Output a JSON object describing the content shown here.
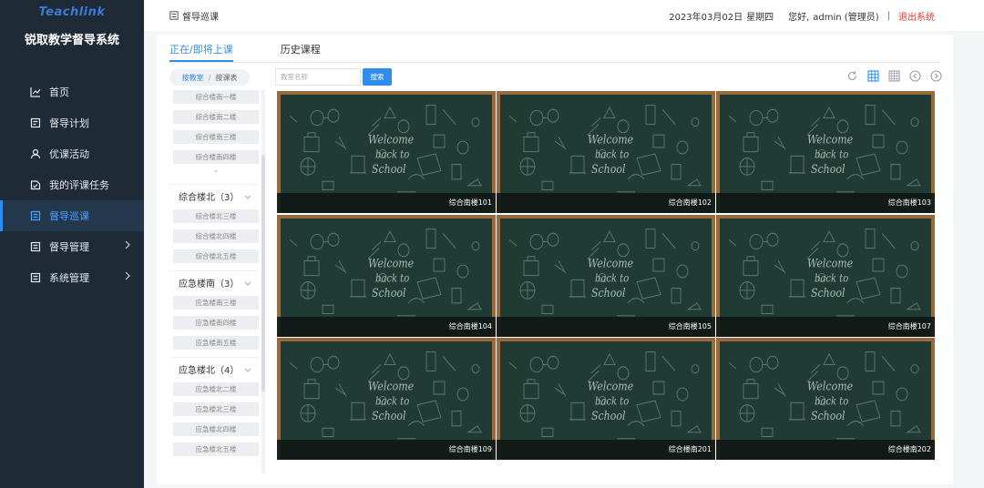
{
  "sidebar": {
    "logo_text": "Teachlink",
    "system_title": "锐取教学督导系统",
    "items": [
      {
        "label": "首页",
        "icon": "chart-icon"
      },
      {
        "label": "督导计划",
        "icon": "plan-icon"
      },
      {
        "label": "优课活动",
        "icon": "activity-icon"
      },
      {
        "label": "我的评课任务",
        "icon": "task-icon"
      },
      {
        "label": "督导巡课",
        "icon": "patrol-icon",
        "active": true
      },
      {
        "label": "督导管理",
        "icon": "manage-icon",
        "expandable": true
      },
      {
        "label": "系统管理",
        "icon": "settings-icon",
        "expandable": true
      }
    ]
  },
  "topbar": {
    "breadcrumb": "督导巡课",
    "date": "2023年03月02日",
    "weekday": "星期四",
    "greeting": "您好,",
    "user": "admin (管理员)",
    "separator": "|",
    "logout": "退出系统"
  },
  "tabs": [
    {
      "label": "正在/即将上课",
      "active": true
    },
    {
      "label": "历史课程",
      "active": false
    }
  ],
  "switcher": {
    "by_room": "按教室",
    "slash": "/",
    "by_schedule": "按课表"
  },
  "building_panel": {
    "top_rooms": [
      "综合楼南一楼",
      "综合楼南二楼",
      "综合楼南三楼",
      "综合楼南四楼"
    ],
    "more_symbol": "⌄",
    "groups": [
      {
        "title": "综合楼北（3）",
        "rooms": [
          "综合楼北三楼",
          "综合楼北四楼",
          "综合楼北五楼"
        ]
      },
      {
        "title": "应急楼南（3）",
        "rooms": [
          "应急楼南三楼",
          "应急楼南四楼",
          "应急楼南五楼"
        ]
      },
      {
        "title": "应急楼北（4）",
        "rooms": [
          "应急楼北二楼",
          "应急楼北三楼",
          "应急楼北四楼",
          "应急楼北五楼"
        ]
      }
    ]
  },
  "search": {
    "placeholder": "教室名称",
    "button": "搜索"
  },
  "view_icons": [
    "refresh-icon",
    "grid-3-icon",
    "grid-4-icon",
    "prev-icon",
    "next-icon"
  ],
  "colors": {
    "accent": "#2f8ded",
    "sidebar": "#1f2a37",
    "logout": "#e53935",
    "board": "#1f3b33",
    "frame": "#9a6a3d"
  },
  "board_text": {
    "line1": "Welcome",
    "line2": "back to",
    "line3": "School"
  },
  "classrooms": [
    "综合南楼101",
    "综合南楼102",
    "综合南楼103",
    "综合南楼104",
    "综合南楼105",
    "综合南楼107",
    "综合南楼109",
    "综合楼南201",
    "综合楼南202"
  ]
}
